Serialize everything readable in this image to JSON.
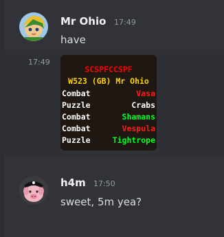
{
  "messages": [
    {
      "username": "Mr Ohio",
      "time": "17:49",
      "text": "have",
      "avatar": "avatar-link"
    },
    {
      "side_time": "17:49",
      "embed": {
        "title": "SCSPFCCSPF",
        "world_line": "W523 (GB) Mr Ohio",
        "rows": [
          {
            "type": "Combat",
            "name": "Vasa",
            "color": "#ff1a1a"
          },
          {
            "type": "Puzzle",
            "name": "Crabs",
            "color": "#ffffff"
          },
          {
            "type": "Combat",
            "name": "Shamans",
            "color": "#00ff22"
          },
          {
            "type": "Combat",
            "name": "Vespula",
            "color": "#ff1a1a"
          },
          {
            "type": "Puzzle",
            "name": "Tightrope",
            "color": "#00ff22"
          }
        ]
      }
    },
    {
      "username": "h4m",
      "time": "17:50",
      "text": "sweet, 5m yea?",
      "avatar": "avatar-pig"
    }
  ],
  "colors": {
    "background": "#313338",
    "hover": "#2e3035",
    "username": "#f2f3f5",
    "timestamp": "#949ba4"
  }
}
